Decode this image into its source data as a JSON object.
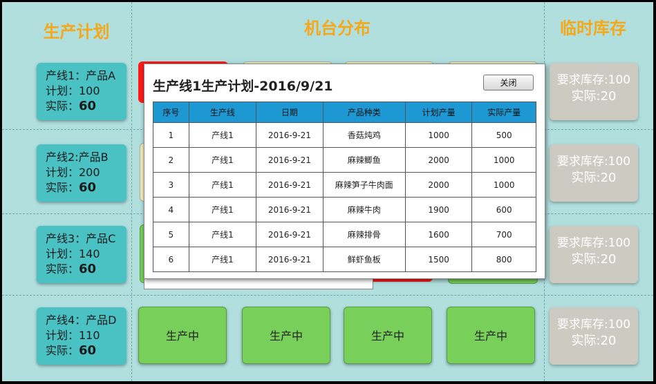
{
  "columns": {
    "plan": "生产计划",
    "machines": "机台分布",
    "stock": "临时库存"
  },
  "plans": [
    {
      "line": "产线1：产品A",
      "plan": "计划：100",
      "actual_label": "实际：",
      "actual_value": "60"
    },
    {
      "line": "产线2:产品B",
      "plan": "计划：200",
      "actual_label": "实际：",
      "actual_value": "60"
    },
    {
      "line": "产线3：产品C",
      "plan": "计划：140",
      "actual_label": "实际：",
      "actual_value": "60"
    },
    {
      "line": "产线4：产品D",
      "plan": "计划：110",
      "actual_label": "实际：",
      "actual_value": "60"
    }
  ],
  "stock": [
    {
      "required": "要求库存:100",
      "actual": "实际:20"
    },
    {
      "required": "要求库存:100",
      "actual": "实际:20"
    },
    {
      "required": "要求库存:100",
      "actual": "实际:20"
    },
    {
      "required": "要求库存:100",
      "actual": "实际:20"
    }
  ],
  "machines_row4": [
    "生产中",
    "生产中",
    "生产中",
    "生产中"
  ],
  "modal": {
    "title": "生产线1生产计划-2016/9/21",
    "close_label": "关闭",
    "headers": [
      "序号",
      "生产线",
      "日期",
      "产品种类",
      "计划产量",
      "实际产量"
    ],
    "rows": [
      [
        "1",
        "产线1",
        "2016-9-21",
        "香菇炖鸡",
        "1000",
        "500"
      ],
      [
        "2",
        "产线1",
        "2016-9-21",
        "麻辣鲫鱼",
        "2000",
        "1000"
      ],
      [
        "3",
        "产线1",
        "2016-9-21",
        "麻辣笋子牛肉面",
        "2000",
        "1000"
      ],
      [
        "4",
        "产线1",
        "2016-9-21",
        "麻辣牛肉",
        "1900",
        "600"
      ],
      [
        "5",
        "产线1",
        "2016-9-21",
        "麻辣排骨",
        "1600",
        "700"
      ],
      [
        "6",
        "产线1",
        "2016-9-21",
        "鲜虾鱼板",
        "1500",
        "800"
      ]
    ]
  },
  "colors": {
    "background": "#b0dfde",
    "title": "#f5a81a",
    "plan_card": "#4ac1c3",
    "stock_card": "#cdcac2",
    "running": "#78d05a",
    "alarm": "#ff1a1a",
    "header": "#1e98d3"
  }
}
